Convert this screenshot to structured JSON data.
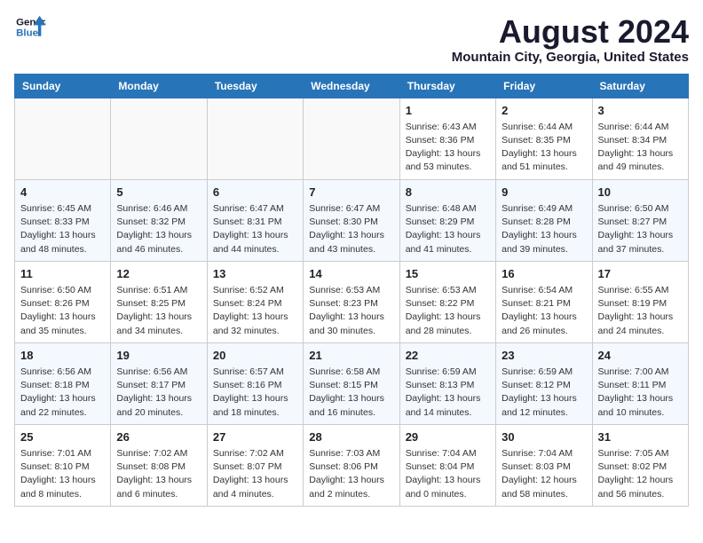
{
  "header": {
    "logo_line1": "General",
    "logo_line2": "Blue",
    "month_year": "August 2024",
    "location": "Mountain City, Georgia, United States"
  },
  "days_of_week": [
    "Sunday",
    "Monday",
    "Tuesday",
    "Wednesday",
    "Thursday",
    "Friday",
    "Saturday"
  ],
  "weeks": [
    [
      {
        "day": "",
        "info": ""
      },
      {
        "day": "",
        "info": ""
      },
      {
        "day": "",
        "info": ""
      },
      {
        "day": "",
        "info": ""
      },
      {
        "day": "1",
        "info": "Sunrise: 6:43 AM\nSunset: 8:36 PM\nDaylight: 13 hours\nand 53 minutes."
      },
      {
        "day": "2",
        "info": "Sunrise: 6:44 AM\nSunset: 8:35 PM\nDaylight: 13 hours\nand 51 minutes."
      },
      {
        "day": "3",
        "info": "Sunrise: 6:44 AM\nSunset: 8:34 PM\nDaylight: 13 hours\nand 49 minutes."
      }
    ],
    [
      {
        "day": "4",
        "info": "Sunrise: 6:45 AM\nSunset: 8:33 PM\nDaylight: 13 hours\nand 48 minutes."
      },
      {
        "day": "5",
        "info": "Sunrise: 6:46 AM\nSunset: 8:32 PM\nDaylight: 13 hours\nand 46 minutes."
      },
      {
        "day": "6",
        "info": "Sunrise: 6:47 AM\nSunset: 8:31 PM\nDaylight: 13 hours\nand 44 minutes."
      },
      {
        "day": "7",
        "info": "Sunrise: 6:47 AM\nSunset: 8:30 PM\nDaylight: 13 hours\nand 43 minutes."
      },
      {
        "day": "8",
        "info": "Sunrise: 6:48 AM\nSunset: 8:29 PM\nDaylight: 13 hours\nand 41 minutes."
      },
      {
        "day": "9",
        "info": "Sunrise: 6:49 AM\nSunset: 8:28 PM\nDaylight: 13 hours\nand 39 minutes."
      },
      {
        "day": "10",
        "info": "Sunrise: 6:50 AM\nSunset: 8:27 PM\nDaylight: 13 hours\nand 37 minutes."
      }
    ],
    [
      {
        "day": "11",
        "info": "Sunrise: 6:50 AM\nSunset: 8:26 PM\nDaylight: 13 hours\nand 35 minutes."
      },
      {
        "day": "12",
        "info": "Sunrise: 6:51 AM\nSunset: 8:25 PM\nDaylight: 13 hours\nand 34 minutes."
      },
      {
        "day": "13",
        "info": "Sunrise: 6:52 AM\nSunset: 8:24 PM\nDaylight: 13 hours\nand 32 minutes."
      },
      {
        "day": "14",
        "info": "Sunrise: 6:53 AM\nSunset: 8:23 PM\nDaylight: 13 hours\nand 30 minutes."
      },
      {
        "day": "15",
        "info": "Sunrise: 6:53 AM\nSunset: 8:22 PM\nDaylight: 13 hours\nand 28 minutes."
      },
      {
        "day": "16",
        "info": "Sunrise: 6:54 AM\nSunset: 8:21 PM\nDaylight: 13 hours\nand 26 minutes."
      },
      {
        "day": "17",
        "info": "Sunrise: 6:55 AM\nSunset: 8:19 PM\nDaylight: 13 hours\nand 24 minutes."
      }
    ],
    [
      {
        "day": "18",
        "info": "Sunrise: 6:56 AM\nSunset: 8:18 PM\nDaylight: 13 hours\nand 22 minutes."
      },
      {
        "day": "19",
        "info": "Sunrise: 6:56 AM\nSunset: 8:17 PM\nDaylight: 13 hours\nand 20 minutes."
      },
      {
        "day": "20",
        "info": "Sunrise: 6:57 AM\nSunset: 8:16 PM\nDaylight: 13 hours\nand 18 minutes."
      },
      {
        "day": "21",
        "info": "Sunrise: 6:58 AM\nSunset: 8:15 PM\nDaylight: 13 hours\nand 16 minutes."
      },
      {
        "day": "22",
        "info": "Sunrise: 6:59 AM\nSunset: 8:13 PM\nDaylight: 13 hours\nand 14 minutes."
      },
      {
        "day": "23",
        "info": "Sunrise: 6:59 AM\nSunset: 8:12 PM\nDaylight: 13 hours\nand 12 minutes."
      },
      {
        "day": "24",
        "info": "Sunrise: 7:00 AM\nSunset: 8:11 PM\nDaylight: 13 hours\nand 10 minutes."
      }
    ],
    [
      {
        "day": "25",
        "info": "Sunrise: 7:01 AM\nSunset: 8:10 PM\nDaylight: 13 hours\nand 8 minutes."
      },
      {
        "day": "26",
        "info": "Sunrise: 7:02 AM\nSunset: 8:08 PM\nDaylight: 13 hours\nand 6 minutes."
      },
      {
        "day": "27",
        "info": "Sunrise: 7:02 AM\nSunset: 8:07 PM\nDaylight: 13 hours\nand 4 minutes."
      },
      {
        "day": "28",
        "info": "Sunrise: 7:03 AM\nSunset: 8:06 PM\nDaylight: 13 hours\nand 2 minutes."
      },
      {
        "day": "29",
        "info": "Sunrise: 7:04 AM\nSunset: 8:04 PM\nDaylight: 13 hours\nand 0 minutes."
      },
      {
        "day": "30",
        "info": "Sunrise: 7:04 AM\nSunset: 8:03 PM\nDaylight: 12 hours\nand 58 minutes."
      },
      {
        "day": "31",
        "info": "Sunrise: 7:05 AM\nSunset: 8:02 PM\nDaylight: 12 hours\nand 56 minutes."
      }
    ]
  ]
}
